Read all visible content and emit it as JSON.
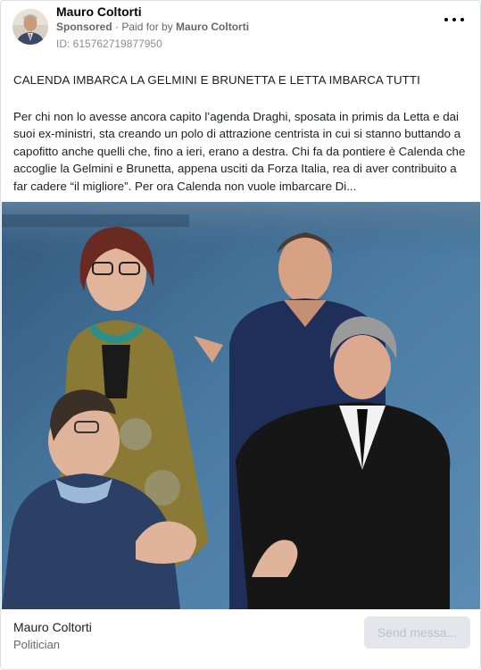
{
  "header": {
    "page_name": "Mauro Coltorti",
    "sponsored_label": "Sponsored",
    "separator": " · ",
    "paid_for_prefix": "Paid for by ",
    "payer_name": "Mauro Coltorti",
    "ad_id": "ID: 615762719877950",
    "more_icon": "more-horizontal-icon"
  },
  "post": {
    "headline": "CALENDA IMBARCA LA GELMINI E BRUNETTA E LETTA IMBARCA TUTTI",
    "body": "Per chi non lo avesse ancora capito l’agenda Draghi, sposata in primis da Letta e dai suoi ex-ministri, sta creando un polo di attrazione centrista in cui si stanno buttando a capofitto anche quelli che, fino a ieri, erano a destra. Chi fa da pontiere è Calenda che accoglie la Gelmini e Brunetta, appena usciti da Forza Italia, rea di aver contribuito a far cadere “il migliore”. Per ora Calenda non vuole imbarcare Di..."
  },
  "footer": {
    "page_name": "Mauro Coltorti",
    "category": "Politician",
    "cta_label": "Send messa..."
  },
  "colors": {
    "image_background": "#3f6e96",
    "cta_background": "#e4e6eb",
    "cta_text": "#bcc0c4",
    "secondary_text": "#65676b"
  }
}
